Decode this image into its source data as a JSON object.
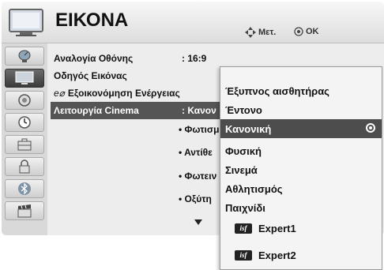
{
  "header": {
    "title": "ΕΙΚΟΝΑ",
    "hint_move": "Μετ.",
    "hint_ok": "OK"
  },
  "sidebar": {
    "items": [
      {
        "icon": "satellite-dish-icon"
      },
      {
        "icon": "tv-screen-icon",
        "active": true
      },
      {
        "icon": "speaker-icon"
      },
      {
        "icon": "clock-icon"
      },
      {
        "icon": "suitcase-icon"
      },
      {
        "icon": "lock-icon"
      },
      {
        "icon": "bluetooth-icon"
      },
      {
        "icon": "clapperboard-icon"
      }
    ]
  },
  "settings": {
    "rows": [
      {
        "label": "Αναλογία Οθόνης",
        "value": ": 16:9"
      },
      {
        "label": "Οδηγός Εικόνας",
        "value": ""
      },
      {
        "label": "Εξοικονόμηση Ενέργειας",
        "value": ""
      },
      {
        "label": "Λειτουργία Cinema",
        "value": ": Κανον"
      }
    ],
    "energy_prefix": "e⌀",
    "sub_items": [
      "• Φωτισμ",
      "• Αντίθε",
      "• Φωτειν",
      "• Οξύτη"
    ]
  },
  "dropdown": {
    "options": [
      {
        "label": "Έξυπνος αισθητήρας"
      },
      {
        "label": "Έντονο"
      },
      {
        "label": "Κανονική",
        "selected": true
      },
      {
        "label": "Φυσική"
      },
      {
        "label": "Σινεμά"
      },
      {
        "label": "Αθλητισμός"
      },
      {
        "label": "Παιχνίδι"
      },
      {
        "label": "Expert1",
        "isf": true
      },
      {
        "label": "Expert2",
        "isf": true
      }
    ],
    "isf_badge": "isf"
  }
}
